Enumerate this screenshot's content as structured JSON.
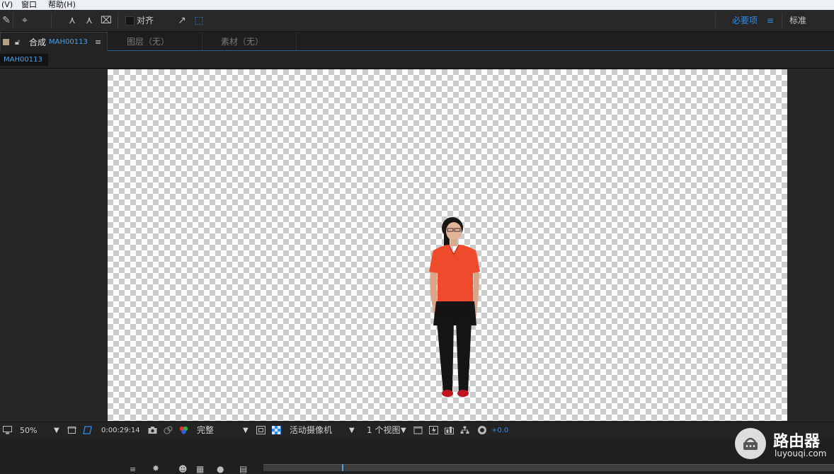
{
  "menu": {
    "view": "(V)",
    "window": "窗口",
    "help": "帮助(H)"
  },
  "toolbar": {
    "snap_label": "对齐"
  },
  "workspace": {
    "active": "必要项",
    "menu_icon": "≡",
    "standard": "标准"
  },
  "panel_tabs": {
    "comp_label": "合成",
    "comp_name": "MAH00113",
    "menu_icon": "≡",
    "layer": "图层（无）",
    "footage": "素材（无）"
  },
  "comp_tab": "MAH00113",
  "viewer_controls": {
    "zoom": "50%",
    "timecode": "0:00:29:14",
    "resolution": "完整",
    "camera": "活动摄像机",
    "views": "1 个视图",
    "exposure": "+0.0"
  },
  "watermark": {
    "title": "路由器",
    "url": "luyouqi.com"
  },
  "colors": {
    "accent": "#2d8ceb",
    "shirt": "#f04a2c",
    "pants": "#151515",
    "shoes": "#c0141c"
  }
}
